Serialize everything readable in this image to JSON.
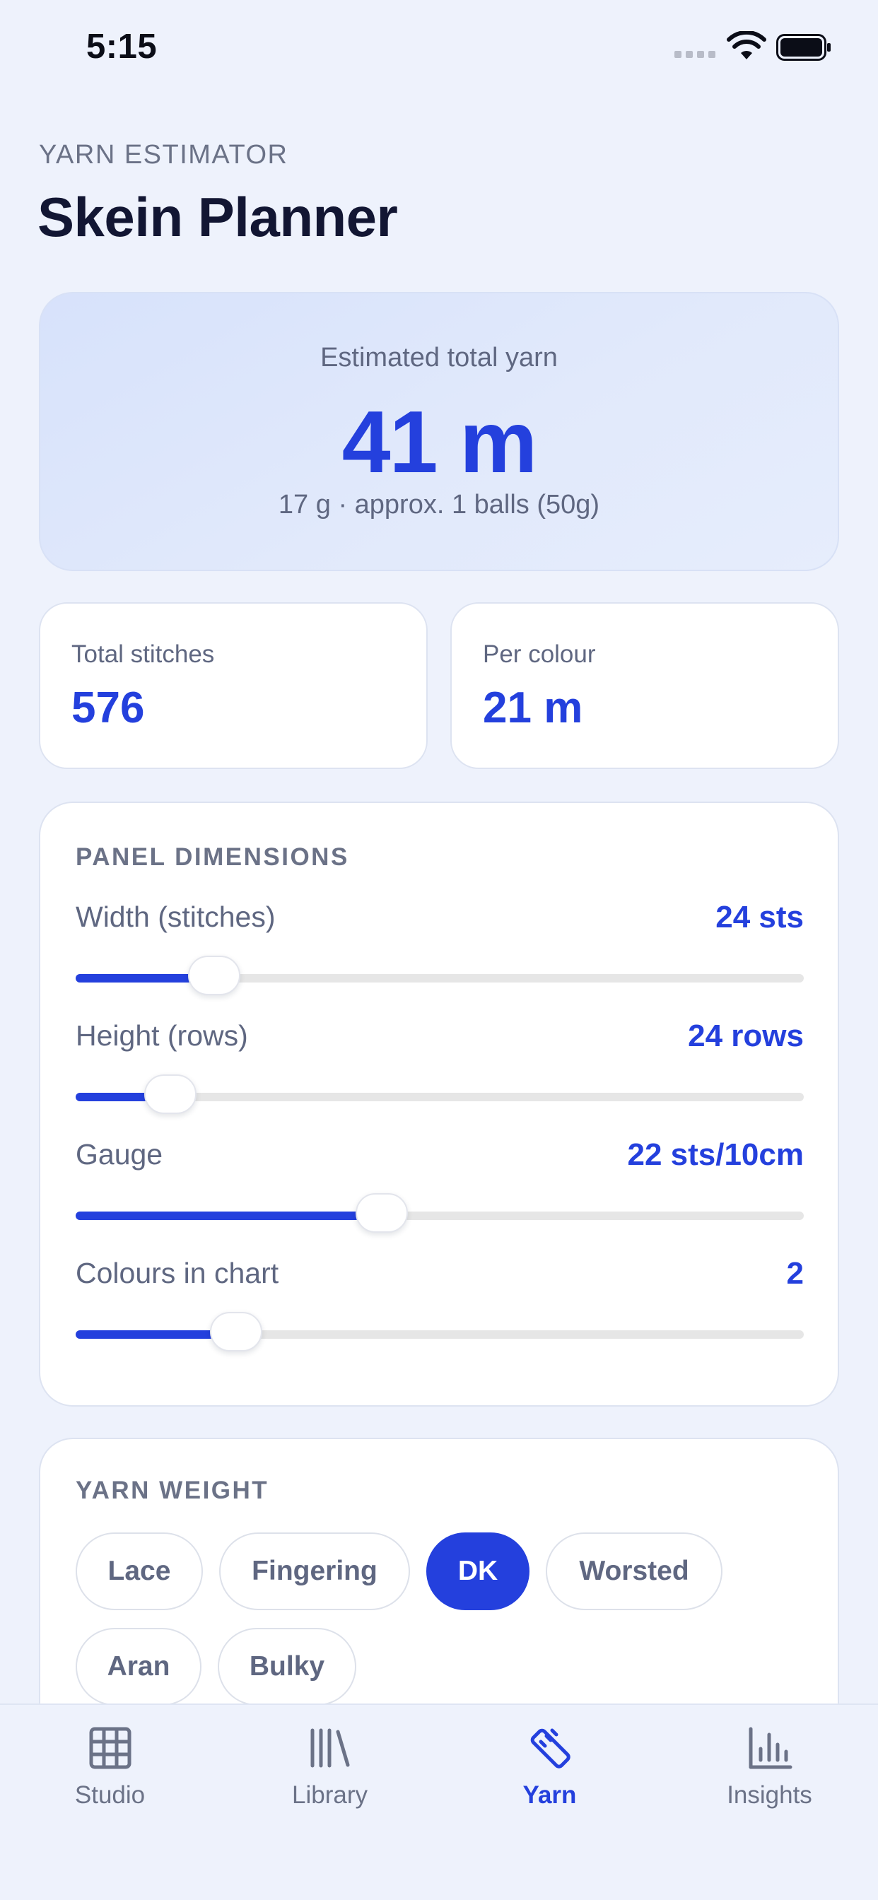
{
  "status_bar": {
    "time": "5:15"
  },
  "header": {
    "eyebrow": "YARN ESTIMATOR",
    "title": "Skein Planner"
  },
  "summary": {
    "label": "Estimated total yarn",
    "value": "41 m",
    "detail": "17 g · approx. 1 balls (50g)"
  },
  "stats": [
    {
      "label": "Total stitches",
      "value": "576"
    },
    {
      "label": "Per colour",
      "value": "21 m"
    }
  ],
  "panel": {
    "title": "PANEL DIMENSIONS",
    "sliders": [
      {
        "label": "Width (stitches)",
        "value": "24 sts",
        "level": 0.19
      },
      {
        "label": "Height (rows)",
        "value": "24 rows",
        "level": 0.13
      },
      {
        "label": "Gauge",
        "value": "22 sts/10cm",
        "level": 0.42
      },
      {
        "label": "Colours in chart",
        "value": "2",
        "level": 0.22
      }
    ]
  },
  "yarn_weight": {
    "title": "YARN WEIGHT",
    "options": [
      "Lace",
      "Fingering",
      "DK",
      "Worsted",
      "Aran",
      "Bulky"
    ],
    "selected": "DK"
  },
  "tabs": [
    {
      "label": "Studio",
      "icon": "grid-icon"
    },
    {
      "label": "Library",
      "icon": "library-icon"
    },
    {
      "label": "Yarn",
      "icon": "ruler-icon",
      "active": true
    },
    {
      "label": "Insights",
      "icon": "bar-chart-icon"
    }
  ],
  "colors": {
    "accent": "#2440dd",
    "background": "#eef2fc"
  }
}
